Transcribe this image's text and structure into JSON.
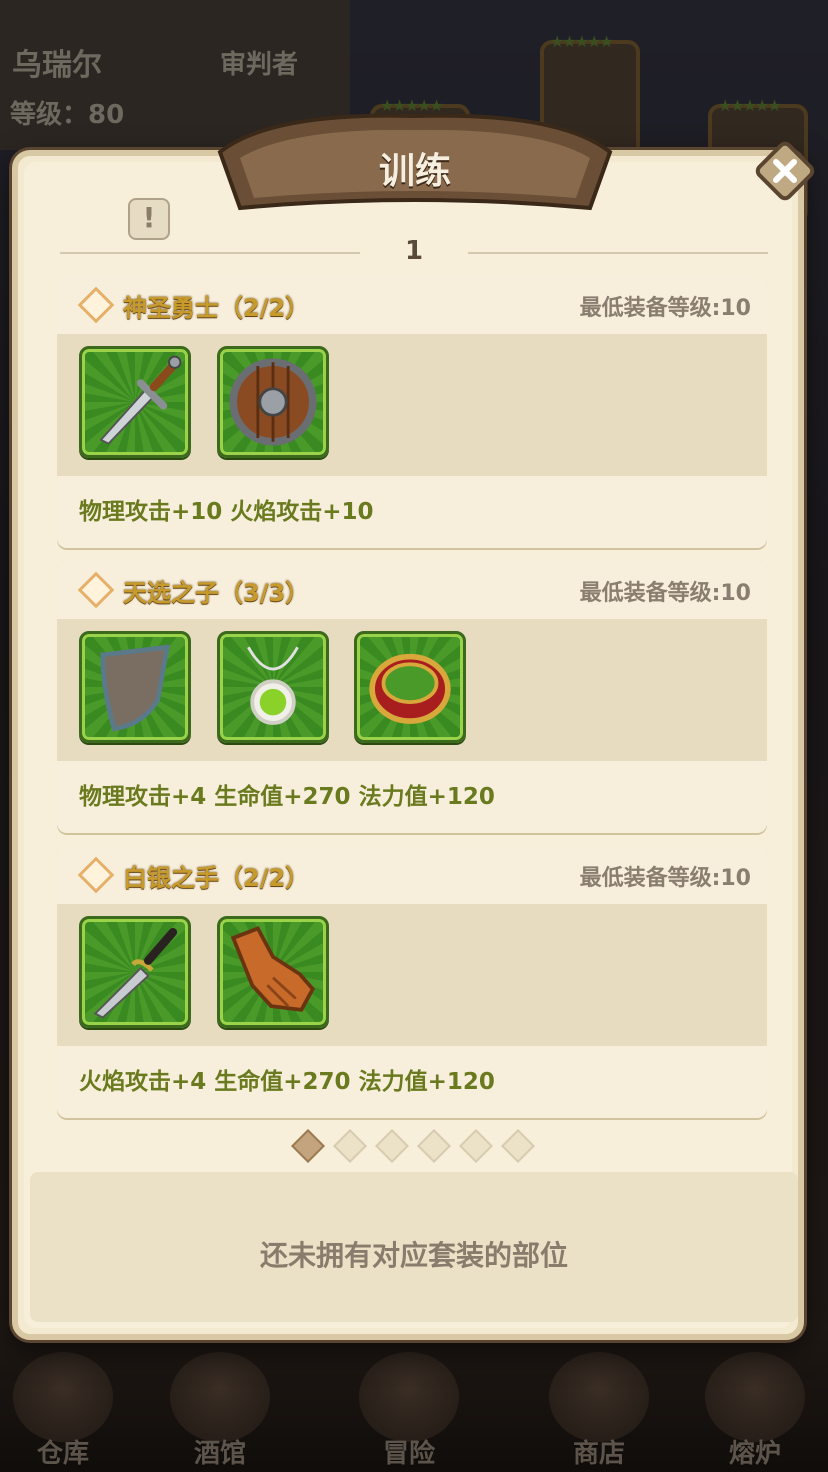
{
  "background": {
    "hero_name": "乌瑞尔",
    "hero_class": "审判者",
    "hero_level": "等级：80"
  },
  "dialog": {
    "title": "训练",
    "page_number": "1",
    "sets": [
      {
        "name": "神圣勇士（2/2）",
        "min_level": "最低装备等级:10",
        "items": [
          "sword-icon",
          "round-shield-icon"
        ],
        "bonus": "物理攻击+10  火焰攻击+10"
      },
      {
        "name": "天选之子（3/3）",
        "min_level": "最低装备等级:10",
        "items": [
          "kite-shield-icon",
          "amulet-icon",
          "ring-icon"
        ],
        "bonus": "物理攻击+4  生命值+270  法力值+120"
      },
      {
        "name": "白银之手（2/2）",
        "min_level": "最低装备等级:10",
        "items": [
          "dagger-icon",
          "glove-icon"
        ],
        "bonus": "火焰攻击+4  生命值+270  法力值+120"
      }
    ],
    "pagination": {
      "total": 6,
      "current": 1
    },
    "status": "还未拥有对应套装的部位"
  },
  "bottom_nav": [
    "仓库",
    "酒馆",
    "冒险",
    "商店",
    "熔炉"
  ],
  "colors": {
    "parchment": "#f7efda",
    "set_name": "#c79a2c",
    "bonus_text": "#6a7a1e",
    "slot_green": "#4a9a2a"
  }
}
